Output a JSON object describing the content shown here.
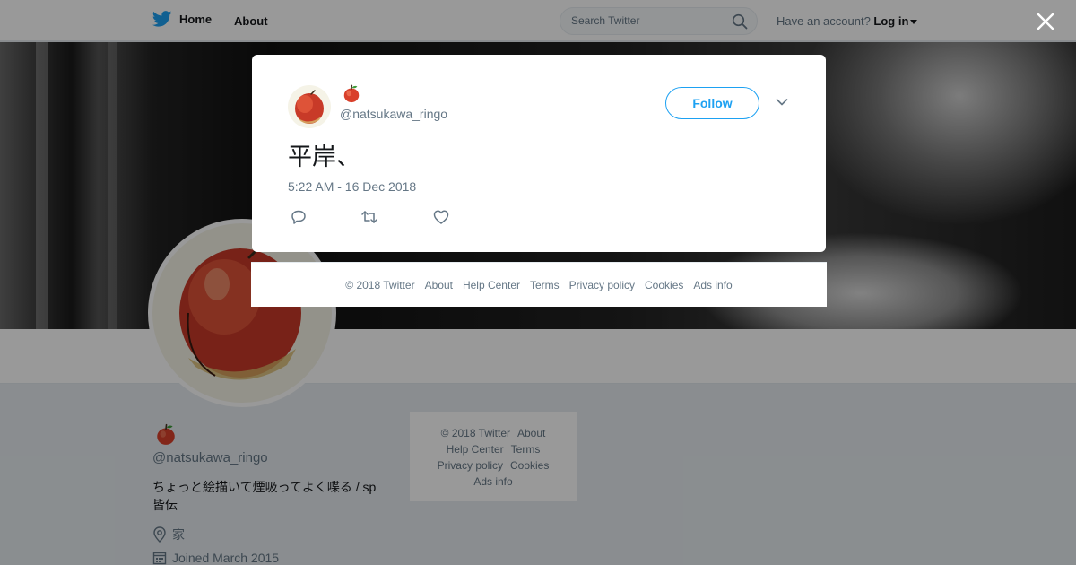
{
  "topbar": {
    "home_label": "Home",
    "about_label": "About",
    "search_placeholder": "Search Twitter",
    "account_prompt": "Have an account?",
    "login_label": "Log in"
  },
  "profile": {
    "name_emoji": "🍎",
    "handle": "@natsukawa_ringo",
    "bio": "ちょっと絵描いて煙吸ってよく喋る / sp皆伝",
    "location": "家",
    "joined": "Joined March 2015"
  },
  "side_footer": {
    "copyright": "© 2018 Twitter",
    "about": "About",
    "help": "Help Center",
    "terms": "Terms",
    "privacy": "Privacy policy",
    "cookies": "Cookies",
    "ads": "Ads info"
  },
  "tweet": {
    "author_emoji": "🍎",
    "handle": "@natsukawa_ringo",
    "follow_label": "Follow",
    "text": "平岸、",
    "timestamp": "5:22 AM - 16 Dec 2018"
  },
  "modal_footer": {
    "copyright": "© 2018 Twitter",
    "about": "About",
    "help": "Help Center",
    "terms": "Terms",
    "privacy": "Privacy policy",
    "cookies": "Cookies",
    "ads": "Ads info"
  },
  "colors": {
    "brand_blue": "#1da1f2",
    "apple_red": "#d9402b",
    "muted_text": "#657786",
    "overlay": "rgba(0,0,0,0.4)"
  },
  "icons": [
    "twitter-bird-icon",
    "search-icon",
    "close-icon",
    "chevron-down-icon",
    "reply-icon",
    "retweet-icon",
    "like-icon",
    "location-pin-icon",
    "calendar-icon",
    "apple-icon"
  ]
}
